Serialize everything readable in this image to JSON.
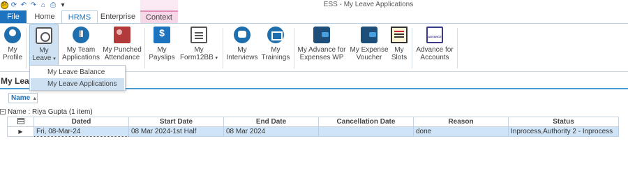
{
  "window": {
    "title": "ESS - My Leave Applications"
  },
  "qat": {
    "app_icon": "app-logo-icon",
    "icons": [
      "refresh-icon",
      "undo-icon",
      "redo-icon",
      "home-icon",
      "print-icon",
      "customize-icon"
    ]
  },
  "tabs": {
    "file": "File",
    "home": "Home",
    "hrms": "HRMS",
    "enterprise": "Enterprise",
    "context": "Context"
  },
  "ribbon": {
    "my_profile": [
      "My",
      "Profile"
    ],
    "my_leave": [
      "My",
      "Leave"
    ],
    "my_team": [
      "My Team",
      "Applications"
    ],
    "my_punched": [
      "My Punched",
      "Attendance"
    ],
    "my_payslips": [
      "My",
      "Payslips"
    ],
    "my_form12bb": [
      "My",
      "Form12BB"
    ],
    "my_interviews": [
      "My",
      "Interviews"
    ],
    "my_trainings": [
      "My",
      "Trainings"
    ],
    "my_advance": [
      "My Advance for",
      "Expenses WP"
    ],
    "my_expense": [
      "My Expense",
      "Voucher"
    ],
    "my_slots": [
      "My",
      "Slots"
    ],
    "advance_accounts": [
      "Advance for",
      "Accounts"
    ]
  },
  "dropdown": {
    "items": [
      "My Leave Balance",
      "My Leave Applications"
    ]
  },
  "page": {
    "title": "My Leave Applications"
  },
  "groupby": {
    "label": "Name",
    "sort": "ascending"
  },
  "group": {
    "toggle": "−",
    "label": "Name : Riya Gupta (1 item)"
  },
  "grid": {
    "columns": [
      "Dated",
      "Start Date",
      "End Date",
      "Cancellation Date",
      "Reason",
      "Status"
    ],
    "rows": [
      {
        "dated": "Fri, 08-Mar-24",
        "start_date": "08 Mar 2024-1st Half",
        "end_date": "08 Mar 2024",
        "cancellation_date": "",
        "reason": "done",
        "status": "Inprocess,Authority 2 - Inprocess"
      }
    ]
  }
}
